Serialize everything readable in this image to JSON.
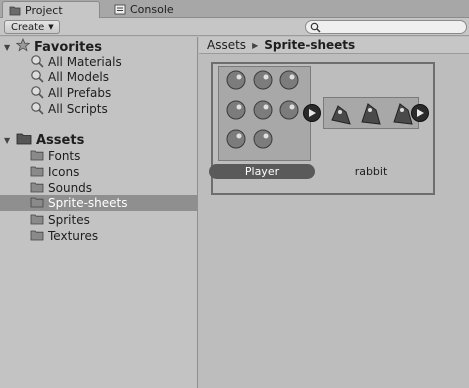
{
  "tabs": [
    {
      "label": "Project",
      "icon": "folder-icon",
      "active": true
    },
    {
      "label": "Console",
      "icon": "console-icon",
      "active": false
    }
  ],
  "toolbar": {
    "create_label": "Create",
    "search_placeholder": ""
  },
  "sidebar": {
    "favorites": {
      "label": "Favorites",
      "items": [
        {
          "label": "All Materials"
        },
        {
          "label": "All Models"
        },
        {
          "label": "All Prefabs"
        },
        {
          "label": "All Scripts"
        }
      ]
    },
    "assets": {
      "label": "Assets",
      "items": [
        {
          "label": "Fonts"
        },
        {
          "label": "Icons"
        },
        {
          "label": "Sounds"
        },
        {
          "label": "Sprite-sheets",
          "selected": true
        },
        {
          "label": "Sprites"
        },
        {
          "label": "Textures"
        }
      ]
    }
  },
  "breadcrumb": {
    "root": "Assets",
    "current": "Sprite-sheets"
  },
  "assets_grid": [
    {
      "name": "Player",
      "selected": true
    },
    {
      "name": "rabbit",
      "selected": false
    }
  ],
  "colors": {
    "selected_row": "#8f8f8f",
    "selected_label_bg": "#5a5a5a",
    "panel_bg": "#c3c3c3"
  }
}
